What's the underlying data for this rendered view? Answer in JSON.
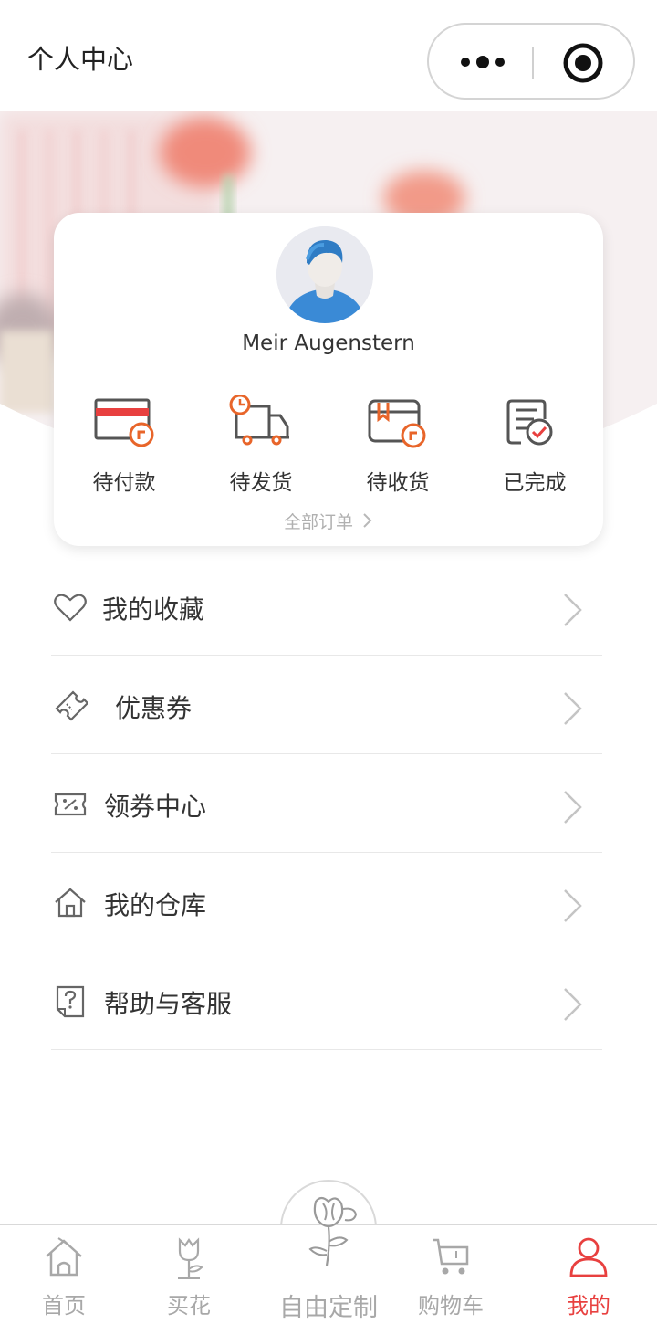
{
  "header": {
    "title": "个人中心"
  },
  "user": {
    "name": "Meir Augenstern"
  },
  "orders": [
    {
      "label": "待付款",
      "icon": "card-pay-icon"
    },
    {
      "label": "待发货",
      "icon": "truck-icon"
    },
    {
      "label": "待收货",
      "icon": "box-receive-icon"
    },
    {
      "label": "已完成",
      "icon": "done-list-icon"
    }
  ],
  "all_orders_label": "全部订单",
  "menu": [
    {
      "label": "我的收藏",
      "icon": "heart-icon"
    },
    {
      "label": "优惠券",
      "icon": "ticket-icon"
    },
    {
      "label": "领券中心",
      "icon": "coupon-percent-icon"
    },
    {
      "label": "我的仓库",
      "icon": "house-icon"
    },
    {
      "label": "帮助与客服",
      "icon": "help-icon"
    }
  ],
  "nav": [
    {
      "label": "首页",
      "icon": "home-icon"
    },
    {
      "label": "买花",
      "icon": "flower-icon"
    },
    {
      "label": "自由定制",
      "icon": "rose-icon"
    },
    {
      "label": "购物车",
      "icon": "cart-icon"
    },
    {
      "label": "我的",
      "icon": "person-icon"
    }
  ],
  "colors": {
    "accent": "#e8403f",
    "orange": "#e8652a",
    "text": "#333333",
    "muted": "#a8a8a8"
  }
}
